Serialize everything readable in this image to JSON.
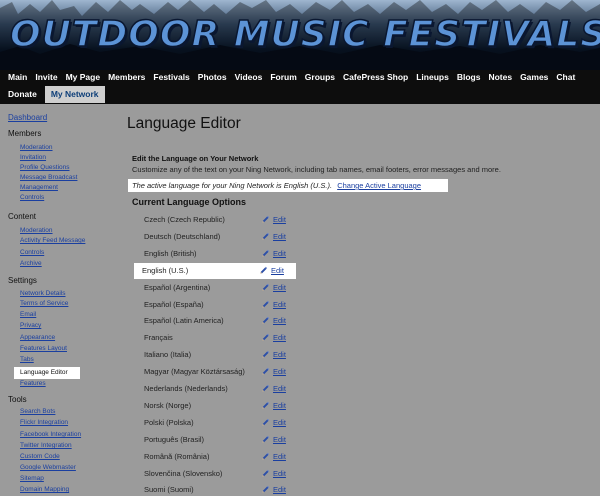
{
  "banner": {
    "title": "OUTDOOR MUSIC FESTIVALS"
  },
  "nav": {
    "row1": [
      "Main",
      "Invite",
      "My Page",
      "Members",
      "Festivals",
      "Photos",
      "Videos",
      "Forum",
      "Groups",
      "CafePress Shop",
      "Lineups",
      "Blogs",
      "Notes",
      "Games",
      "Chat"
    ],
    "row2": [
      "Donate",
      "My Network"
    ],
    "active": "My Network"
  },
  "sidebar": {
    "dashboard": "Dashboard",
    "sections": [
      {
        "heading": "Members",
        "links": [
          "Moderation",
          "Invitation",
          "Profile Questions",
          "Message Broadcast",
          "Management",
          "Controls"
        ]
      },
      {
        "heading": "Content",
        "links": [
          "Moderation",
          "Activity Feed Message",
          "Controls",
          "Archive"
        ]
      },
      {
        "heading": "Settings",
        "links": [
          "Network Details",
          "Terms of Service",
          "Email",
          "Privacy",
          "Appearance",
          "Features Layout",
          "Tabs",
          "Language Editor",
          "Features"
        ],
        "selected": "Language Editor"
      },
      {
        "heading": "Tools",
        "links": [
          "Search Bots",
          "Flickr Integration",
          "Facebook Integration",
          "Twitter Integration",
          "Custom Code",
          "Google Webmaster",
          "Sitemap",
          "Domain Mapping"
        ]
      }
    ]
  },
  "main": {
    "title": "Language Editor",
    "section_title": "Edit the Language on Your Network",
    "section_desc": "Customize any of the text on your Ning Network, including tab names, email footers, error messages and more.",
    "active_language_text": "The active language for your Ning Network is English (U.S.).",
    "change_link": "Change Active Language",
    "list_heading": "Current Language Options",
    "edit_label": "Edit",
    "languages": [
      "Czech (Czech Republic)",
      "Deutsch (Deutschland)",
      "English (British)",
      "English (U.S.)",
      "Español (Argentina)",
      "Español (España)",
      "Español (Latin America)",
      "Français",
      "Italiano (Italia)",
      "Magyar (Magyar Köztársaság)",
      "Nederlands (Nederlands)",
      "Norsk (Norge)",
      "Polski (Polska)",
      "Português (Brasil)",
      "Română (România)",
      "Slovenčina (Slovensko)",
      "Suomi (Suomi)"
    ],
    "selected_language": "English (U.S.)"
  },
  "icons": {
    "edit": "pencil-icon"
  },
  "colors": {
    "link": "#1a3fa0",
    "page_bg": "#9b9b9b",
    "nav_bg": "#0d0d0d",
    "banner_text": "#5c93d6"
  }
}
